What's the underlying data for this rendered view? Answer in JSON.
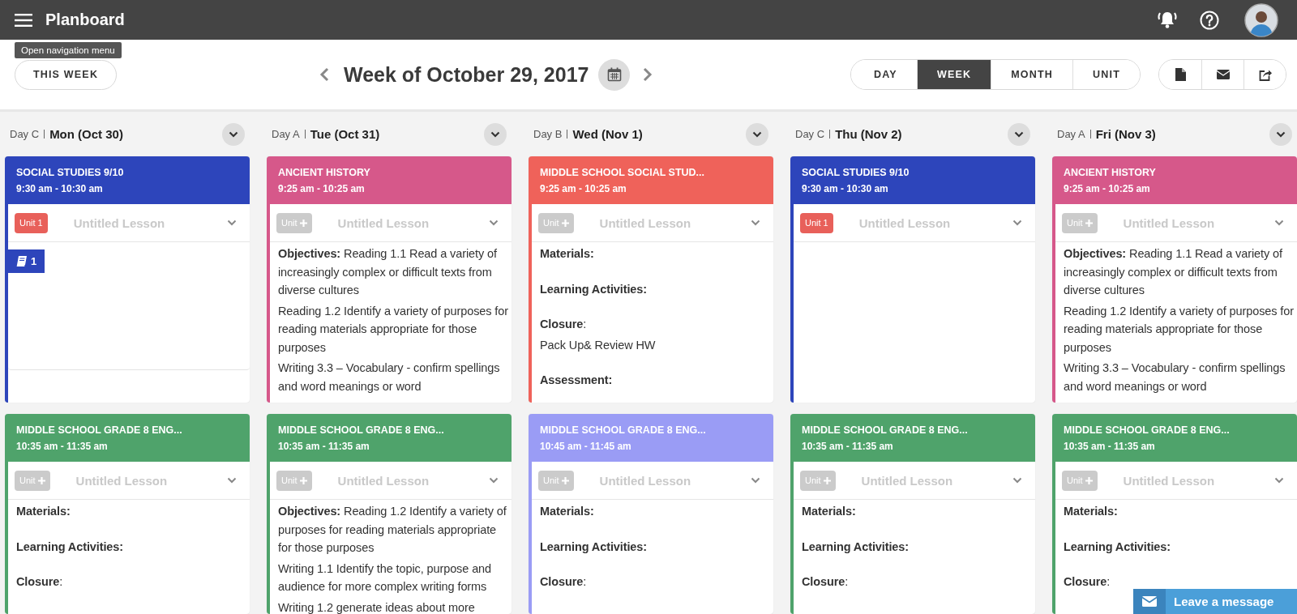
{
  "app": {
    "title": "Planboard",
    "tooltip": "Open navigation menu"
  },
  "toolbar": {
    "this_week": "THIS WEEK",
    "week_title": "Week of October 29, 2017",
    "views": [
      {
        "label": "DAY",
        "selected": false
      },
      {
        "label": "WEEK",
        "selected": true
      },
      {
        "label": "MONTH",
        "selected": false
      },
      {
        "label": "UNIT",
        "selected": false
      }
    ]
  },
  "days": [
    {
      "day_label": "Day C",
      "date": "Mon (Oct 30)",
      "lessons": [
        {
          "title": "SOCIAL STUDIES 9/10",
          "time": "9:30 am - 10:30 am",
          "color": "#2d45bb",
          "unit": {
            "label": "Unit 1",
            "kind": "assigned"
          },
          "lesson_title": "Untitled Lesson",
          "resources": "1"
        },
        {
          "title": "MIDDLE SCHOOL GRADE 8 ENG...",
          "time": "10:35 am - 11:35 am",
          "color": "#4fa36b",
          "unit": {
            "label": "Unit",
            "kind": "add"
          },
          "lesson_title": "Untitled Lesson",
          "sections": [
            [
              "**Materials:**"
            ],
            [
              "**Learning Activities:**"
            ],
            [
              "**Closure**:"
            ]
          ]
        }
      ]
    },
    {
      "day_label": "Day A",
      "date": "Tue (Oct 31)",
      "lessons": [
        {
          "title": "ANCIENT HISTORY",
          "time": "9:25 am - 10:25 am",
          "color": "#d6588a",
          "unit": {
            "label": "Unit",
            "kind": "add"
          },
          "lesson_title": "Untitled Lesson",
          "sections": [
            [
              "**Objectives:** Reading 1.1 Read a variety of increasingly complex or difficult texts from diverse cultures",
              "Reading 1.2 Identify a variety of purposes for reading materials appropriate for those purposes",
              "Writing 3.3 – Vocabulary - confirm spellings and word meanings or word"
            ]
          ]
        },
        {
          "title": "MIDDLE SCHOOL GRADE 8 ENG...",
          "time": "10:35 am - 11:35 am",
          "color": "#4fa36b",
          "unit": {
            "label": "Unit",
            "kind": "add"
          },
          "lesson_title": "Untitled Lesson",
          "sections": [
            [
              "**Objectives:** Reading 1.2 Identify a variety of purposes for reading materials appropriate for those purposes",
              "Writing 1.1 Identify the topic, purpose and audience for more complex writing forms",
              "Writing 1.2 generate ideas about more"
            ]
          ]
        }
      ]
    },
    {
      "day_label": "Day B",
      "date": "Wed (Nov 1)",
      "lessons": [
        {
          "title": "MIDDLE SCHOOL SOCIAL STUD...",
          "time": "9:25 am - 10:25 am",
          "color": "#ef625a",
          "unit": {
            "label": "Unit",
            "kind": "add"
          },
          "lesson_title": "Untitled Lesson",
          "sections": [
            [
              "**Materials:**"
            ],
            [
              "**Learning Activities:**"
            ],
            [
              "**Closure**:",
              "Pack Up& Review HW"
            ],
            [
              "**Assessment:**"
            ]
          ]
        },
        {
          "title": "MIDDLE SCHOOL GRADE 8 ENG...",
          "time": "10:45 am - 11:45 am",
          "color": "#9a9cf5",
          "unit": {
            "label": "Unit",
            "kind": "add"
          },
          "lesson_title": "Untitled Lesson",
          "sections": [
            [
              "**Materials:**"
            ],
            [
              "**Learning Activities:**"
            ],
            [
              "**Closure**:"
            ]
          ]
        }
      ]
    },
    {
      "day_label": "Day C",
      "date": "Thu (Nov 2)",
      "lessons": [
        {
          "title": "SOCIAL STUDIES 9/10",
          "time": "9:30 am - 10:30 am",
          "color": "#2d45bb",
          "unit": {
            "label": "Unit 1",
            "kind": "assigned"
          },
          "lesson_title": "Untitled Lesson"
        },
        {
          "title": "MIDDLE SCHOOL GRADE 8 ENG...",
          "time": "10:35 am - 11:35 am",
          "color": "#4fa36b",
          "unit": {
            "label": "Unit",
            "kind": "add"
          },
          "lesson_title": "Untitled Lesson",
          "sections": [
            [
              "**Materials:**"
            ],
            [
              "**Learning Activities:**"
            ],
            [
              "**Closure**:"
            ]
          ]
        }
      ]
    },
    {
      "day_label": "Day A",
      "date": "Fri (Nov 3)",
      "lessons": [
        {
          "title": "ANCIENT HISTORY",
          "time": "9:25 am - 10:25 am",
          "color": "#d6588a",
          "unit": {
            "label": "Unit",
            "kind": "add"
          },
          "lesson_title": "Untitled Lesson",
          "sections": [
            [
              "**Objectives:** Reading 1.1 Read a variety of increasingly complex or difficult texts from diverse cultures",
              "Reading 1.2 Identify a variety of purposes for reading materials appropriate for those purposes",
              "Writing 3.3 – Vocabulary - confirm spellings and word meanings or word"
            ]
          ]
        },
        {
          "title": "MIDDLE SCHOOL GRADE 8 ENG...",
          "time": "10:35 am - 11:35 am",
          "color": "#4fa36b",
          "unit": {
            "label": "Unit",
            "kind": "add"
          },
          "lesson_title": "Untitled Lesson",
          "sections": [
            [
              "**Materials:**"
            ],
            [
              "**Learning Activities:**"
            ],
            [
              "**Closure**:"
            ]
          ]
        }
      ]
    }
  ],
  "chat": {
    "label": "Leave a message"
  }
}
